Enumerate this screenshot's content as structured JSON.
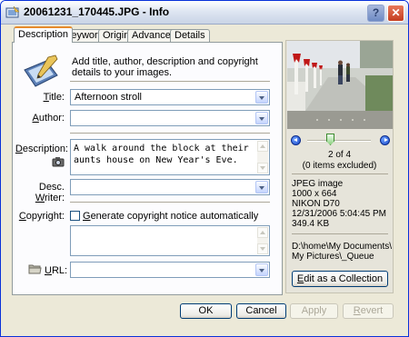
{
  "window": {
    "title": "20061231_170445.JPG - Info",
    "help_glyph": "?",
    "close_glyph": "✕"
  },
  "tabs": [
    {
      "label": "Description",
      "active": true
    },
    {
      "label": "Keywords",
      "active": false
    },
    {
      "label": "Origin",
      "active": false
    },
    {
      "label": "Advanced",
      "active": false
    },
    {
      "label": "Details",
      "active": false
    }
  ],
  "intro": {
    "text": "Add title, author, description and copyright details to your images."
  },
  "fields": {
    "title": {
      "label_u": "T",
      "label_rest": "itle:",
      "value": "Afternoon stroll"
    },
    "author": {
      "label_u": "A",
      "label_rest": "uthor:",
      "value": ""
    },
    "description": {
      "label_u": "D",
      "label_rest": "escription:",
      "value": "A walk around the block at their aunts house on New Year's Eve."
    },
    "desc_writer": {
      "label_pre": "Desc. ",
      "label_u": "W",
      "label_rest": "riter:",
      "value": ""
    },
    "copyright": {
      "label_u": "C",
      "label_rest": "opyright:",
      "checkbox_u": "G",
      "checkbox_rest": "enerate copyright notice automatically",
      "checked": false,
      "value": ""
    },
    "url": {
      "label_u": "U",
      "label_rest": "RL:",
      "value": ""
    }
  },
  "preview": {
    "position": "2 of 4",
    "excluded": "(0 items excluded)",
    "file_type": "JPEG image",
    "dimensions": "1000 x 664",
    "camera": "NIKON D70",
    "datetime": "12/31/2006 5:04:45 PM",
    "size": "349.4 KB",
    "path_line1": "D:\\home\\My Documents\\",
    "path_line2": "My Pictures\\_Queue",
    "edit_u": "E",
    "edit_rest": "dit as a Collection"
  },
  "buttons": {
    "ok": "OK",
    "cancel": "Cancel",
    "apply": "Apply",
    "revert_u": "R",
    "revert_rest": "evert"
  },
  "colors": {
    "window_bg": "#ece9d8",
    "active_tab_accent": "#e68b2c",
    "close_button": "#c43d1f"
  },
  "icons": [
    "app-icon",
    "help-icon",
    "close-icon",
    "pen-tablet-icon",
    "camera-icon",
    "folder-icon",
    "prev-arrow-icon",
    "next-arrow-icon"
  ]
}
